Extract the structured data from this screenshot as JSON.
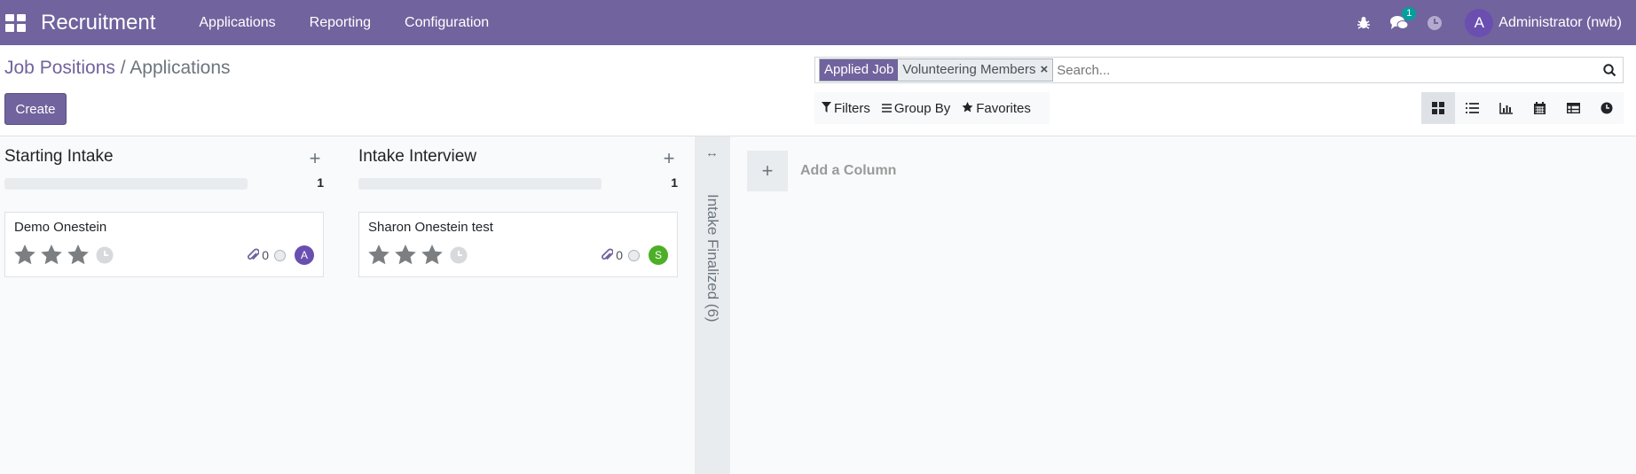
{
  "navbar": {
    "brand": "Recruitment",
    "menu": [
      {
        "label": "Applications"
      },
      {
        "label": "Reporting"
      },
      {
        "label": "Configuration"
      }
    ],
    "messages_count": "1",
    "user": {
      "initial": "A",
      "name": "Administrator (nwb)"
    }
  },
  "breadcrumb": {
    "parent": "Job Positions",
    "separator": "/",
    "current": "Applications"
  },
  "create_label": "Create",
  "search": {
    "facet_category": "Applied Job",
    "facet_value": "Volunteering Members",
    "placeholder": "Search..."
  },
  "filters": {
    "filters_label": "Filters",
    "group_by_label": "Group By",
    "favorites_label": "Favorites"
  },
  "views": [
    "kanban-view-icon",
    "list-view-icon",
    "graph-view-icon",
    "calendar-view-icon",
    "pivot-view-icon",
    "activity-view-icon"
  ],
  "columns": [
    {
      "title": "Starting Intake",
      "count": "1",
      "cards": [
        {
          "name": "Demo Onestein",
          "attachments": "0",
          "avatar": "A",
          "avatar_color": "#6a4fb0"
        }
      ]
    },
    {
      "title": "Intake Interview",
      "count": "1",
      "cards": [
        {
          "name": "Sharon Onestein test",
          "attachments": "0",
          "avatar": "S",
          "avatar_color": "#4caf27"
        }
      ]
    }
  ],
  "folded_column": {
    "title": "Intake Finalized (6)"
  },
  "add_column_label": "Add a Column",
  "colors": {
    "brand": "#71639e",
    "badge": "#00a09d"
  }
}
